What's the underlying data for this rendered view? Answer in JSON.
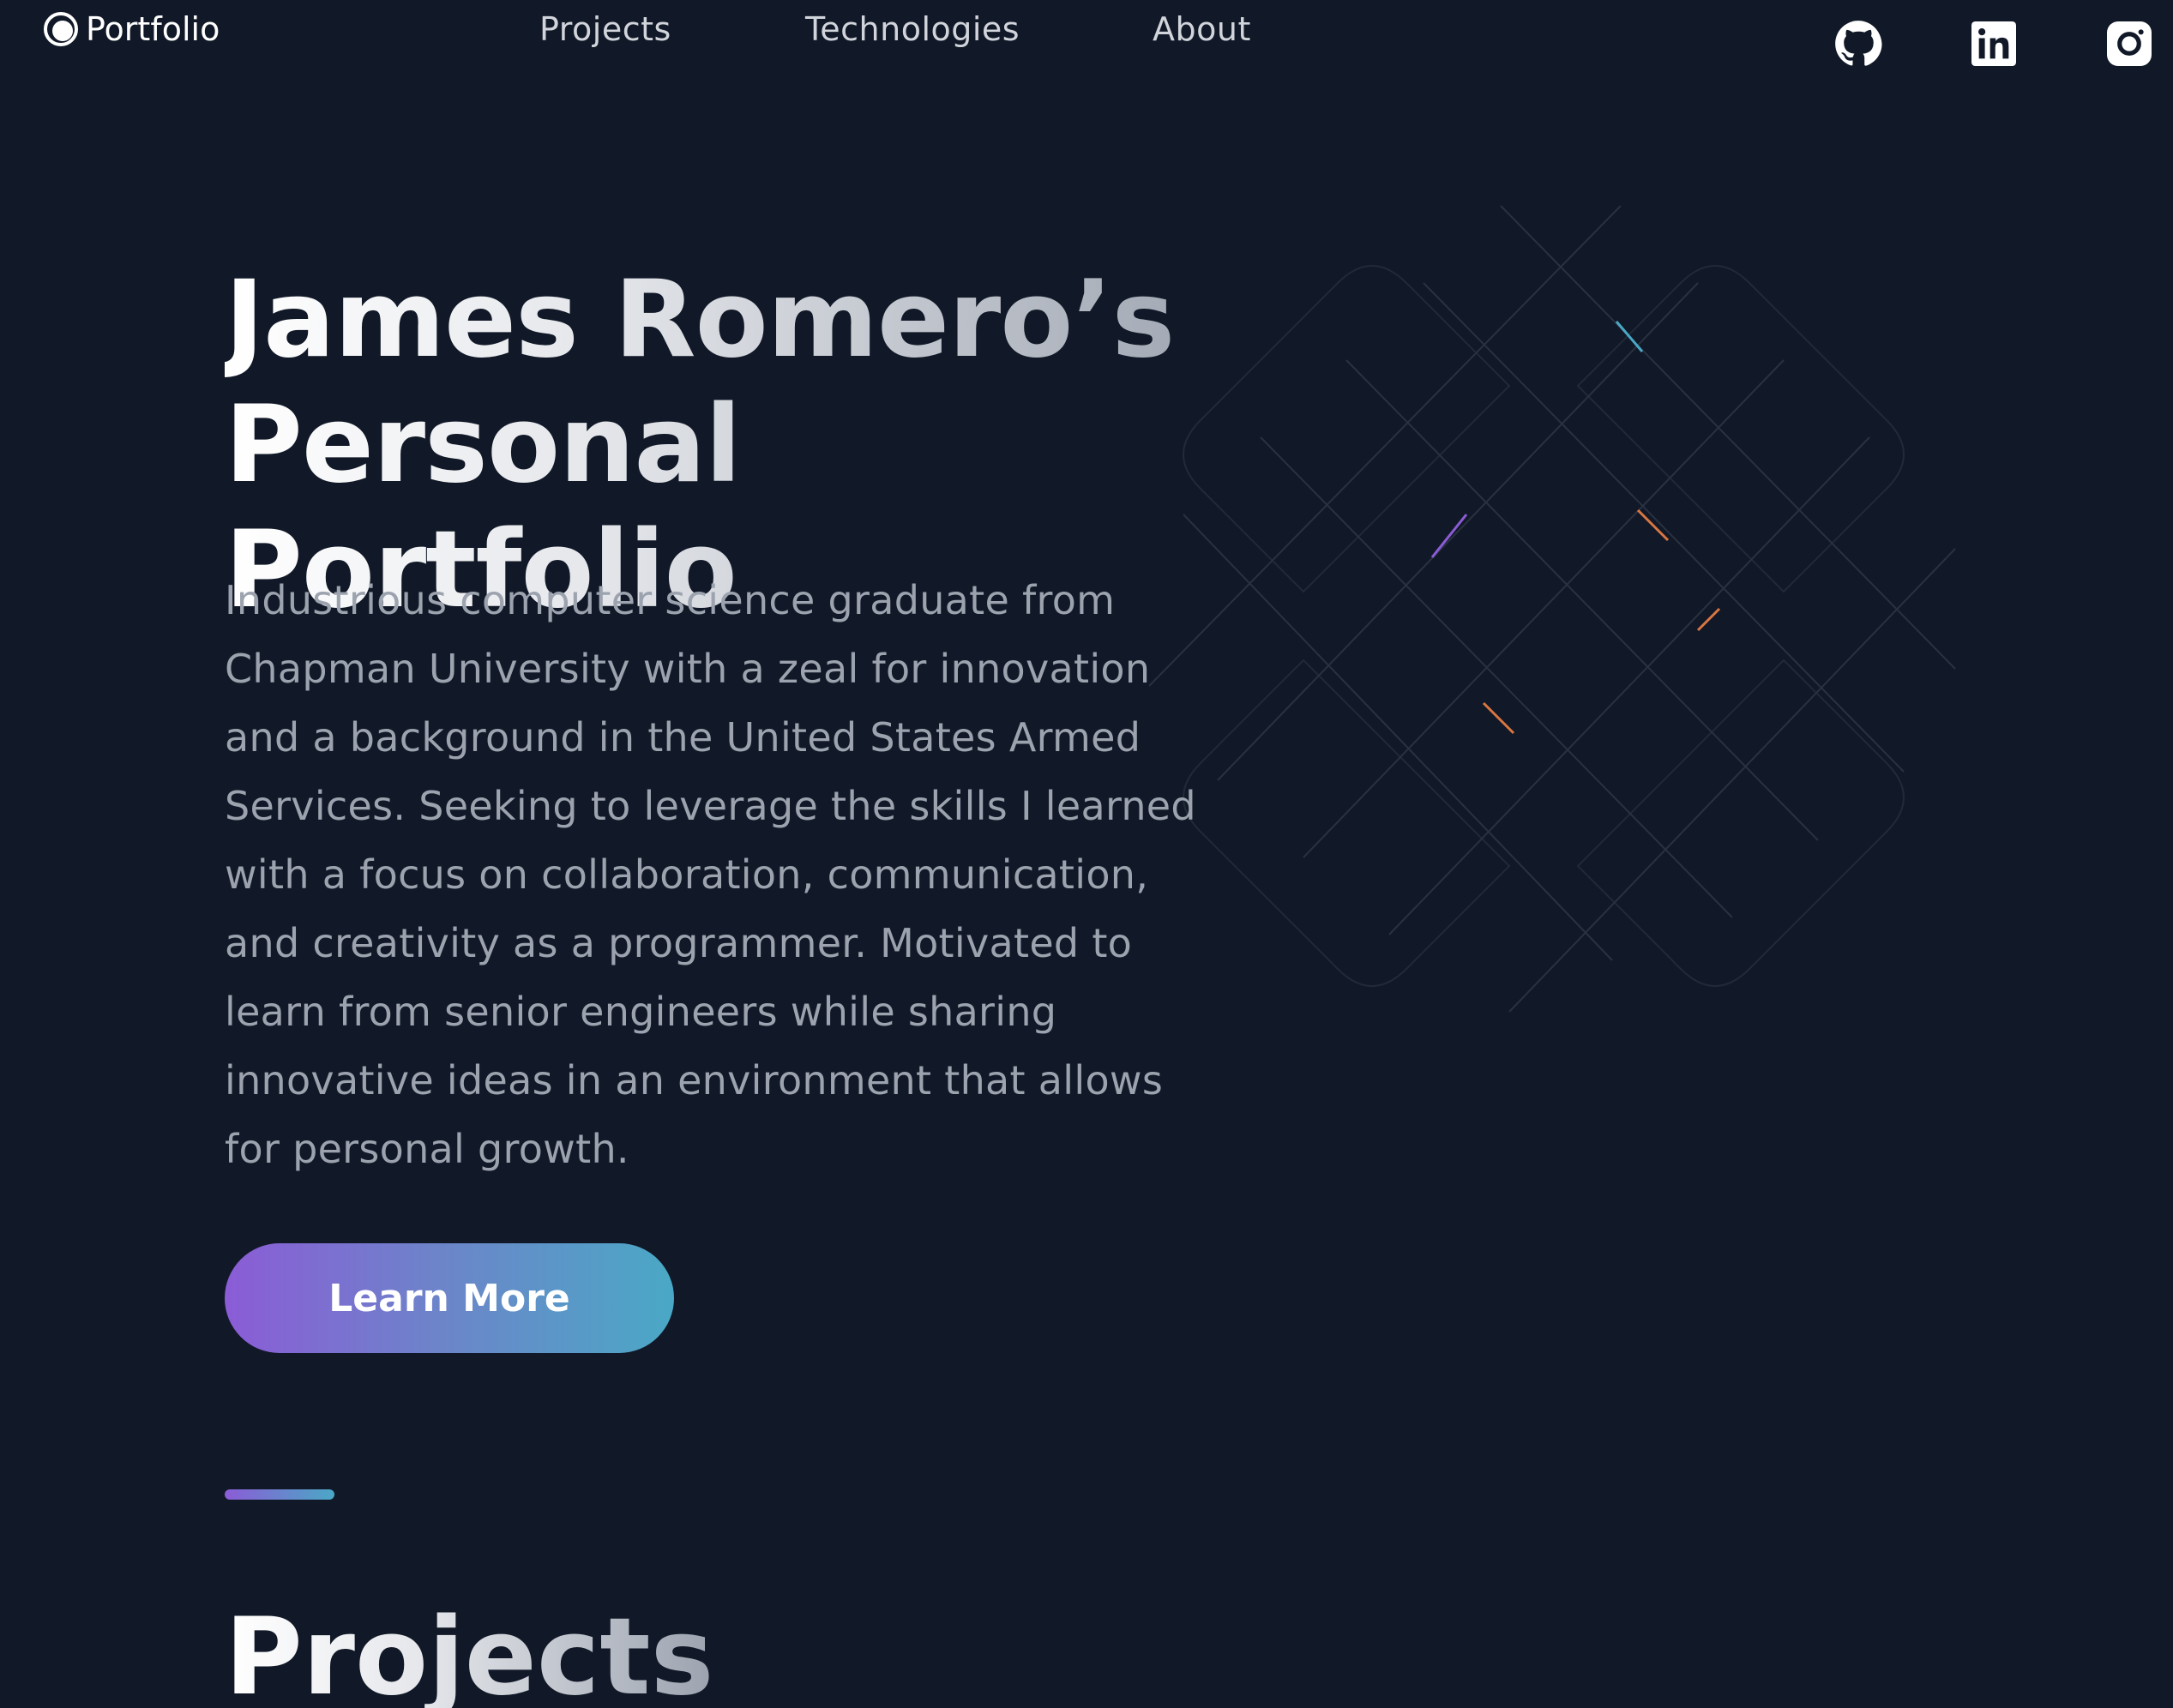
{
  "nav": {
    "brand": "Portfolio",
    "links": [
      "Projects",
      "Technologies",
      "About"
    ],
    "social": [
      "github-icon",
      "linkedin-icon",
      "instagram-icon"
    ]
  },
  "hero": {
    "title_line1": "James Romero’s",
    "title_line2": "Personal Portfolio",
    "description": "Industrious computer science graduate from Chapman University with a zeal for innovation and a background in the United States Armed Services. Seeking to leverage the skills I learned with a focus on collaboration, communication, and creativity as a programmer. Motivated to learn from senior engineers while sharing innovative ideas in an environment that allows for personal growth.",
    "cta": "Learn More"
  },
  "projects": {
    "title": "Projects"
  },
  "colors": {
    "background": "#111827",
    "accent_start": "#8b5cd6",
    "accent_end": "#4aa8c6",
    "text_muted": "#9ca3af"
  }
}
